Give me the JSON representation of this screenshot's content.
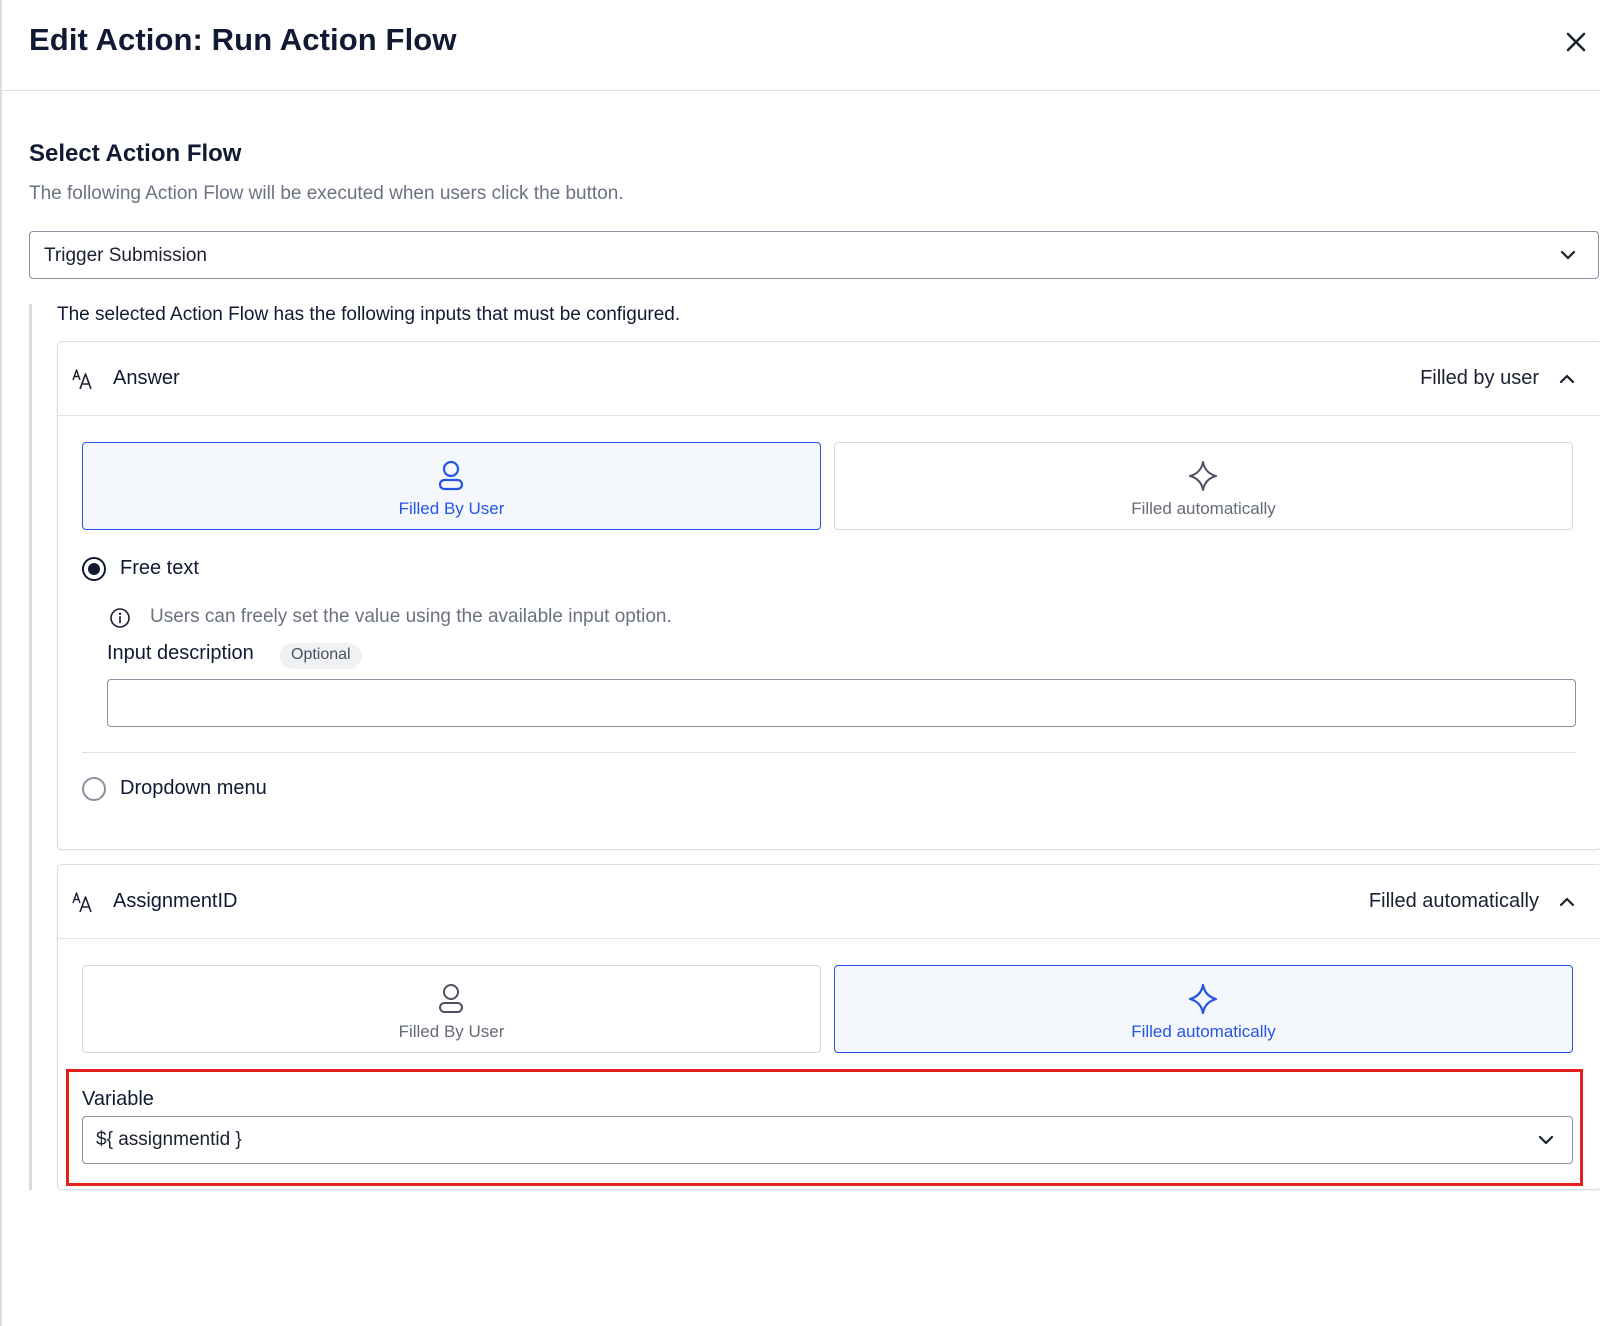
{
  "dialog": {
    "title": "Edit Action: Run Action Flow",
    "close_icon": "close-icon"
  },
  "select_action_flow": {
    "title": "Select Action Flow",
    "description": "The following Action Flow will be executed when users click the button.",
    "selected_value": "Trigger Submission",
    "dropdown_icon": "chevron-down-icon"
  },
  "inputs": {
    "note": "The selected Action Flow has the following inputs that must be configured.",
    "answer": {
      "name": "Answer",
      "status": "Filled by user",
      "type_icon": "text-type-icon",
      "mode_user_label": "Filled By User",
      "mode_auto_label": "Filled automatically",
      "selected_mode": "user",
      "free_text_label": "Free text",
      "free_text_info": "Users can freely set the value using the available input option.",
      "input_description_label": "Input description",
      "optional_badge": "Optional",
      "input_description_value": "",
      "dropdown_menu_label": "Dropdown menu",
      "selected_option": "free_text"
    },
    "assignment_id": {
      "name": "AssignmentID",
      "status": "Filled automatically",
      "type_icon": "text-type-icon",
      "mode_user_label": "Filled By User",
      "mode_auto_label": "Filled automatically",
      "selected_mode": "auto",
      "variable_label": "Variable",
      "variable_value": "${ assignmentid }"
    }
  },
  "colors": {
    "accent": "#2554e6",
    "highlight": "#e3201b",
    "title": "#111a33"
  }
}
